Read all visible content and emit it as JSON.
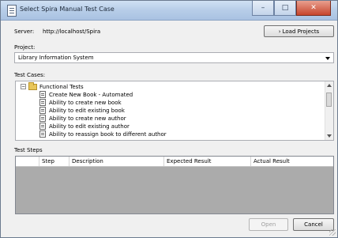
{
  "window": {
    "title": "Select Spira Manual Test Case",
    "minimize_glyph": "–",
    "maximize_glyph": "□",
    "close_glyph": "✕"
  },
  "server": {
    "label": "Server:",
    "value": "http://localhost/Spira",
    "load_projects_label": "Load Projects"
  },
  "project": {
    "label": "Project:",
    "selected": "Library Information System"
  },
  "test_cases": {
    "label": "Test Cases:",
    "folder": "Functional Tests",
    "items": [
      "Create New Book - Automated",
      "Ability to create new book",
      "Ability to edit existing book",
      "Ability to create new author",
      "Ability to edit existing author",
      "Ability to reassign book to different author"
    ]
  },
  "test_steps": {
    "label": "Test Steps",
    "columns": [
      "Step",
      "Description",
      "Expected Result",
      "Actual Result"
    ]
  },
  "footer": {
    "open_label": "Open",
    "cancel_label": "Cancel"
  },
  "icons": {
    "title": "document-icon",
    "folder": "folder-icon",
    "test_case": "test-case-icon"
  }
}
